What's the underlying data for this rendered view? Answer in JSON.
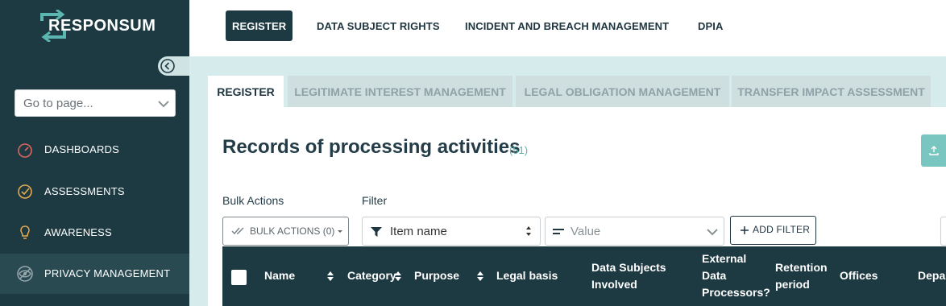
{
  "brand": {
    "name": "RESPONSUM"
  },
  "sidebar": {
    "goto_placeholder": "Go to page...",
    "items": [
      {
        "label": "DASHBOARDS",
        "icon": "gauge-icon"
      },
      {
        "label": "ASSESSMENTS",
        "icon": "check-circle-icon"
      },
      {
        "label": "AWARENESS",
        "icon": "lightbulb-icon"
      },
      {
        "label": "PRIVACY MANAGEMENT",
        "icon": "eye-shield-icon",
        "active": true
      }
    ]
  },
  "topnav": {
    "tabs": [
      {
        "label": "REGISTER",
        "active": true
      },
      {
        "label": "DATA SUBJECT RIGHTS"
      },
      {
        "label": "INCIDENT AND BREACH MANAGEMENT"
      },
      {
        "label": "DPIA"
      }
    ]
  },
  "subtabs": [
    {
      "label": "REGISTER",
      "active": true
    },
    {
      "label": "LEGITIMATE INTEREST MANAGEMENT"
    },
    {
      "label": "LEGAL OBLIGATION MANAGEMENT"
    },
    {
      "label": "TRANSFER IMPACT ASSESSMENT"
    }
  ],
  "page": {
    "title": "Records of processing activities",
    "count": "(51)"
  },
  "toolbar": {
    "bulk_label": "Bulk Actions",
    "bulk_button": "BULK ACTIONS (0)",
    "filter_label": "Filter",
    "filter_field": "Item name",
    "value_placeholder": "Value",
    "add_filter": "ADD FILTER"
  },
  "table": {
    "columns": {
      "name": "Name",
      "category": "Category",
      "purpose": "Purpose",
      "legal_basis": "Legal basis",
      "data_subjects_1": "Data Subjects",
      "data_subjects_2": "Involved",
      "external_1": "External",
      "external_2": "Data",
      "external_3": "Processors?",
      "retention_1": "Retention",
      "retention_2": "period",
      "offices": "Offices",
      "departments": "Departments"
    }
  },
  "colors": {
    "sidebar_bg": "#1d3a42",
    "accent": "#79c6c1",
    "main_bg": "#d6ecec"
  }
}
